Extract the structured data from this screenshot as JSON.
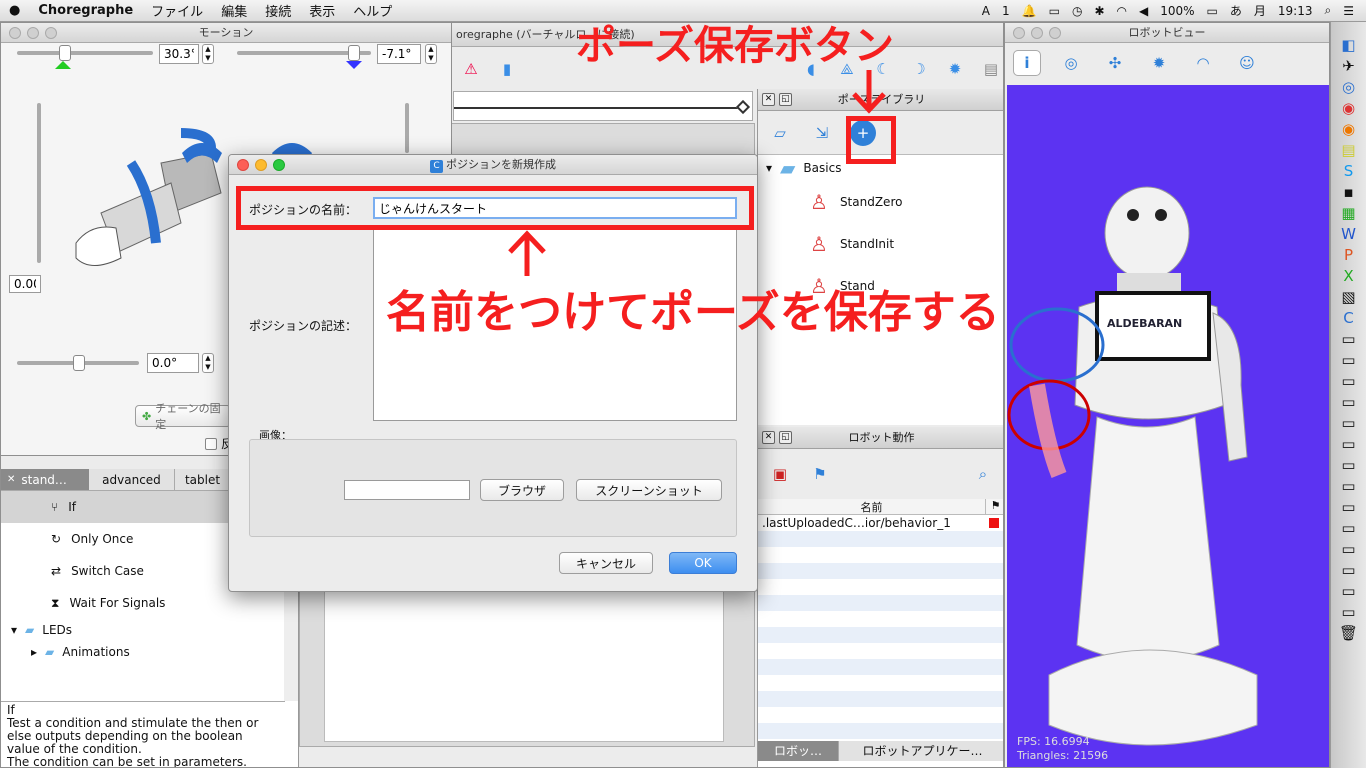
{
  "menubar": {
    "apple": "",
    "app_name": "Choregraphe",
    "items": [
      "ファイル",
      "編集",
      "接続",
      "表示",
      "ヘルプ"
    ],
    "status": {
      "notif": "1",
      "battery": "100%",
      "day": "月",
      "time": "19:13"
    }
  },
  "main_window": {
    "title": "oregraphe (バーチャルロ…に接続)"
  },
  "motion_window": {
    "title": "モーション",
    "slider1_value": "30.3°",
    "slider2_value": "-7.1°",
    "left_value": "0.00",
    "bottom_value": "0.0°",
    "chain_button": "チェーンの固定",
    "mirror_checkbox": "反"
  },
  "box_library": {
    "tabs": [
      "stand…",
      "advanced",
      "tablet"
    ],
    "items": [
      {
        "label": "If",
        "icon": "branch-icon",
        "selected": true
      },
      {
        "label": "Only Once",
        "icon": "loop-icon"
      },
      {
        "label": "Switch Case",
        "icon": "switch-icon"
      },
      {
        "label": "Wait For Signals",
        "icon": "hourglass-icon"
      }
    ],
    "folders": [
      {
        "label": "LEDs"
      },
      {
        "label": "Animations"
      }
    ],
    "description": "If\nTest a condition and stimulate the then or else outputs depending on the boolean value of the condition.\nThe condition can be set in parameters."
  },
  "pose_library": {
    "title": "ポーズライブラリ",
    "root": "Basics",
    "items": [
      "StandZero",
      "StandInit",
      "Stand"
    ]
  },
  "robot_behavior": {
    "title": "ロボット動作",
    "col_name": "名前",
    "row": ".lastUploadedC…ior/behavior_1",
    "tabs": [
      "ロボッ…",
      "ロボットアプリケー…"
    ]
  },
  "robot_view": {
    "title": "ロボットビュー",
    "logo": "ALDEBARAN",
    "fps": "FPS: 16.6994",
    "triangles": "Triangles: 21596"
  },
  "dialog": {
    "title": "ポジションを新規作成",
    "name_label": "ポジションの名前：",
    "name_value": "じゃんけんスタート",
    "desc_label": "ポジションの記述：",
    "image_label": "画像：",
    "browse": "ブラウザ",
    "screenshot": "スクリーンショット",
    "cancel": "キャンセル",
    "ok": "OK"
  },
  "annotations": {
    "top": "ポーズ保存ボタン",
    "middle": "名前をつけてポーズを保存する",
    "color": "#f51f1f"
  },
  "colors": {
    "accent": "#3d8ef0",
    "robot_bg": "#5c33f2"
  }
}
